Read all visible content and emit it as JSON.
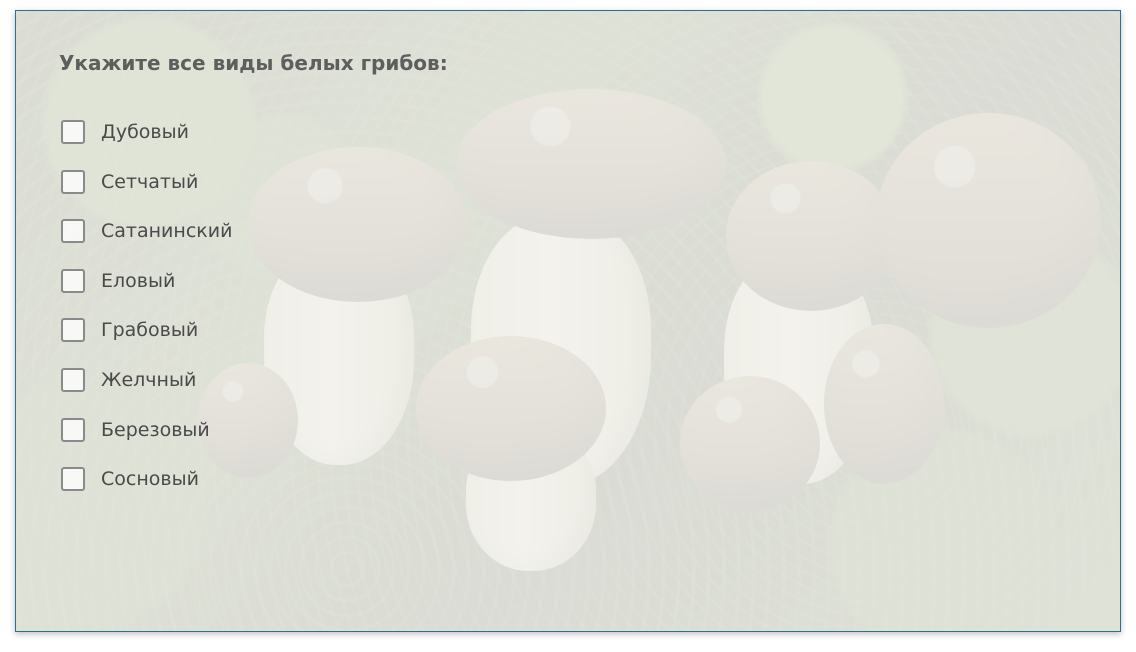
{
  "quiz": {
    "question": "Укажите все виды белых грибов:",
    "options": [
      {
        "label": "Дубовый",
        "checked": false
      },
      {
        "label": "Сетчатый",
        "checked": false
      },
      {
        "label": "Сатанинский",
        "checked": false
      },
      {
        "label": "Еловый",
        "checked": false
      },
      {
        "label": "Грабовый",
        "checked": false
      },
      {
        "label": "Желчный",
        "checked": false
      },
      {
        "label": "Березовый",
        "checked": false
      },
      {
        "label": "Сосновый",
        "checked": false
      }
    ]
  },
  "theme": {
    "accent_border": "#2f6f8e",
    "question_text": "#5e5e5e",
    "option_text": "#4a4a4a",
    "checkbox_border": "#8a8a8a"
  }
}
